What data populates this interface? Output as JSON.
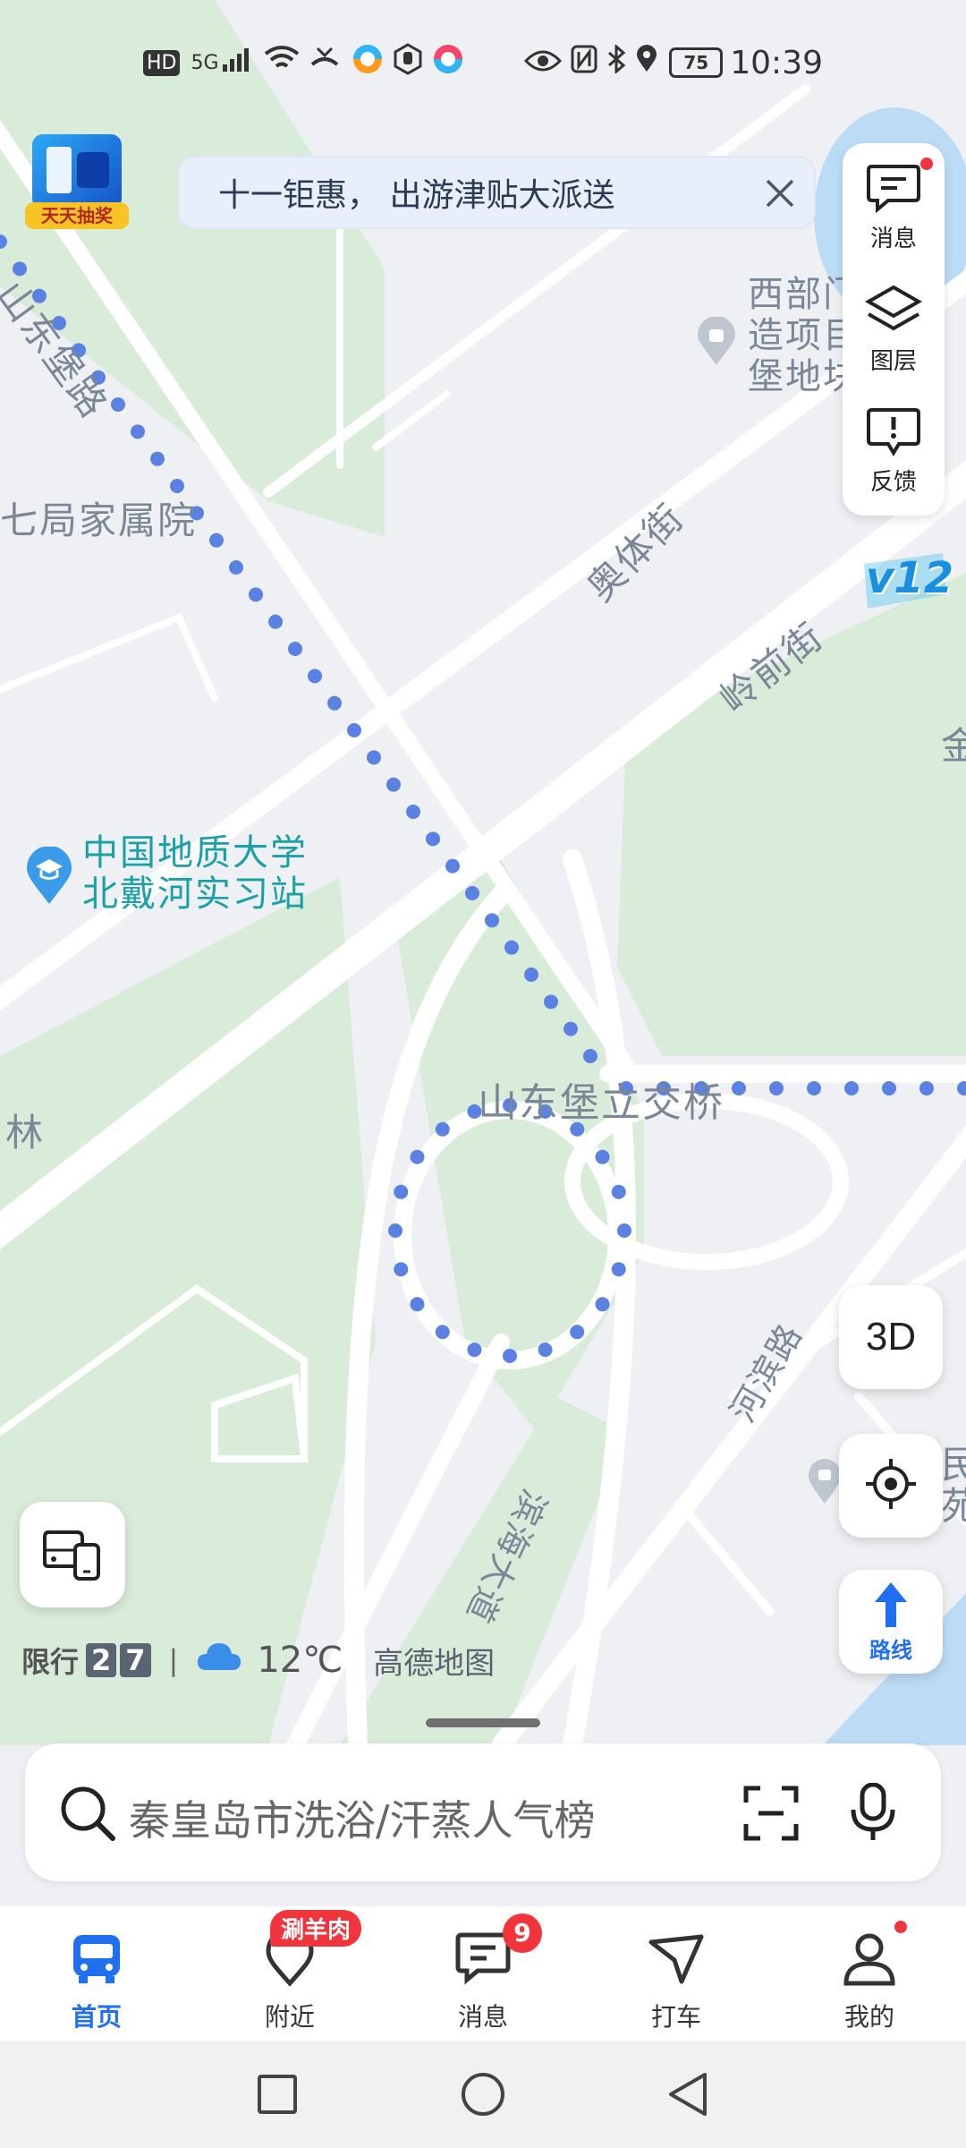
{
  "status_bar": {
    "left_label": "HD",
    "network": "5G",
    "battery": "75",
    "time": "10:39"
  },
  "lottery_badge": "天天抽奖",
  "banner": {
    "text": "十一钜惠， 出游津贴大派送"
  },
  "right_panel": {
    "messages_label": "消息",
    "layers_label": "图层",
    "feedback_label": "反馈"
  },
  "map_labels": {
    "road_shandongpu": "山东堡路",
    "road_aoti": "奥体街",
    "road_lingqian": "岭前街",
    "poi_west": "西部门",
    "poi_west_line2": "造项目",
    "poi_west_line3": "堡地块",
    "family": "七局家属院",
    "university_line1": "中国地质大学",
    "university_line2": "北戴河实习站",
    "interchange": "山东堡立交桥",
    "lin": "林",
    "jin": "金",
    "binhai": "滨海大道",
    "hebin": "河滨路",
    "min_1": "民",
    "min_2": "苑"
  },
  "v12_badge": "v12",
  "map_controls": {
    "three_d": "3D",
    "route": "路线"
  },
  "info_row": {
    "restriction_label": "限行",
    "restriction_digit1": "2",
    "restriction_digit2": "7",
    "separator": "|",
    "weather_temp": "12℃",
    "map_logo": "高德地图"
  },
  "search": {
    "placeholder": "秦皇岛市洗浴/汗蒸人气榜"
  },
  "bottom_nav": {
    "home": "首页",
    "nearby": "附近",
    "nearby_badge": "涮羊肉",
    "messages": "消息",
    "messages_badge": "9",
    "taxi": "打车",
    "mine": "我的"
  },
  "colors": {
    "accent": "#1f6ff0",
    "badge_red": "#f2353c",
    "park_green": "#d9ecd9",
    "route_dot": "#5b82e3",
    "water": "#bcdcf5"
  }
}
